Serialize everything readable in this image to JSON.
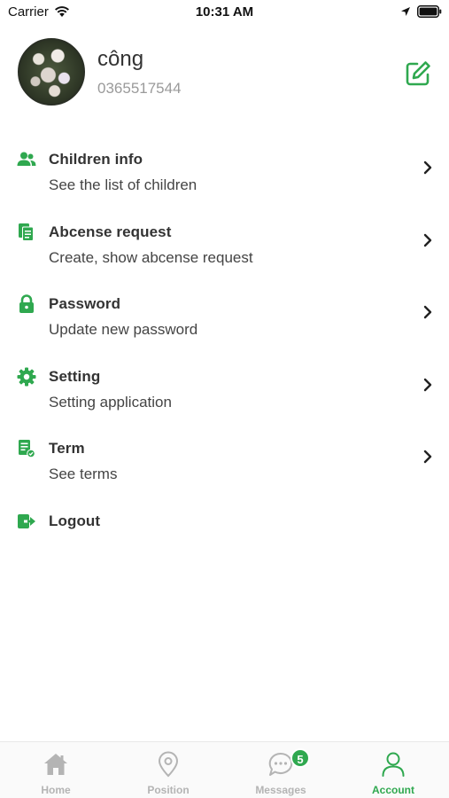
{
  "status_bar": {
    "carrier": "Carrier",
    "time": "10:31 AM"
  },
  "profile": {
    "name": "công",
    "phone": "0365517544"
  },
  "colors": {
    "accent": "#2fa84f",
    "tab_inactive": "#b4b4b4"
  },
  "menu": [
    {
      "icon": "children-icon",
      "title": "Children info",
      "subtitle": "See the list of children",
      "chevron": true
    },
    {
      "icon": "documents-icon",
      "title": "Abcense request",
      "subtitle": "Create, show abcense request",
      "chevron": true
    },
    {
      "icon": "lock-icon",
      "title": "Password",
      "subtitle": "Update new password",
      "chevron": true
    },
    {
      "icon": "gear-icon",
      "title": "Setting",
      "subtitle": "Setting application",
      "chevron": true
    },
    {
      "icon": "term-icon",
      "title": "Term",
      "subtitle": "See terms",
      "chevron": true
    },
    {
      "icon": "logout-icon",
      "title": "Logout",
      "subtitle": "",
      "chevron": false
    }
  ],
  "tabs": [
    {
      "icon": "home-icon",
      "label": "Home",
      "active": false
    },
    {
      "icon": "location-pin-icon",
      "label": "Position",
      "active": false
    },
    {
      "icon": "chat-icon",
      "label": "Messages",
      "active": false,
      "badge": "5"
    },
    {
      "icon": "user-icon",
      "label": "Account",
      "active": true
    }
  ]
}
